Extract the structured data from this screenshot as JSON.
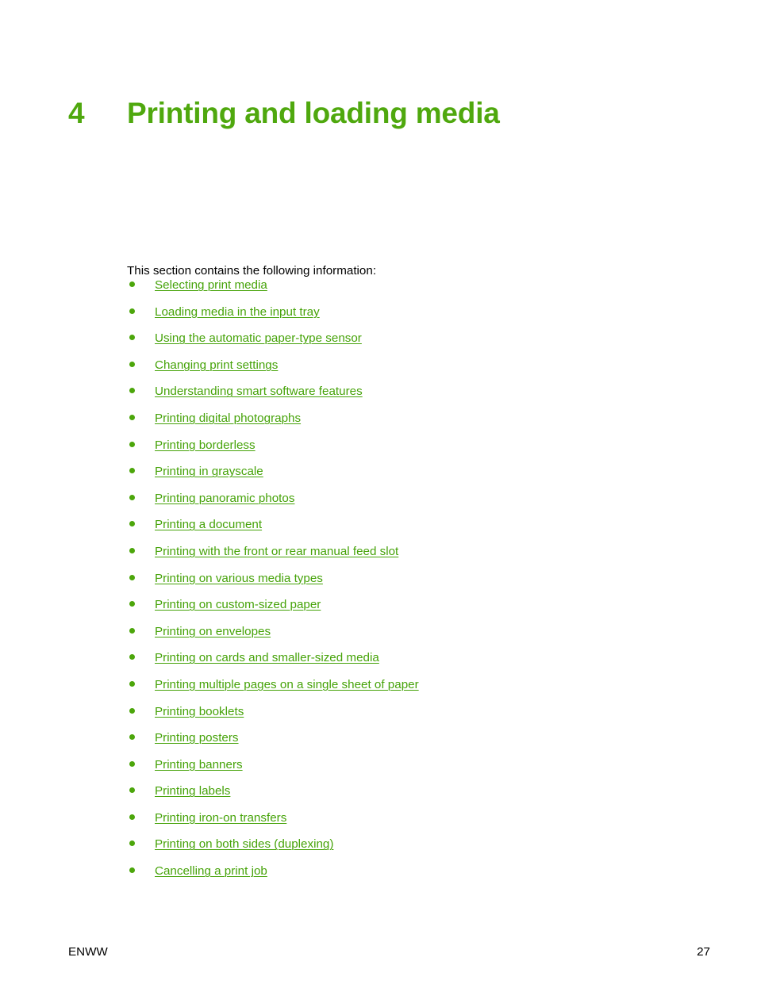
{
  "document": {
    "chapter_number": "4",
    "chapter_title": "Printing and loading media",
    "intro_text": "This section contains the following information:",
    "heading_color": "#4fa80e",
    "link_color": "#46a309",
    "bullet_color": "#4ca60b",
    "body_color": "#000000",
    "page_background": "#ffffff"
  },
  "toc_links": [
    {
      "label": "Selecting print media"
    },
    {
      "label": "Loading media in the input tray"
    },
    {
      "label": "Using the automatic paper-type sensor"
    },
    {
      "label": "Changing print settings"
    },
    {
      "label": "Understanding smart software features"
    },
    {
      "label": "Printing digital photographs"
    },
    {
      "label": "Printing borderless"
    },
    {
      "label": "Printing in grayscale"
    },
    {
      "label": "Printing panoramic photos"
    },
    {
      "label": "Printing a document"
    },
    {
      "label": "Printing with the front or rear manual feed slot"
    },
    {
      "label": "Printing on various media types"
    },
    {
      "label": "Printing on custom-sized paper"
    },
    {
      "label": "Printing on envelopes"
    },
    {
      "label": "Printing on cards and smaller-sized media"
    },
    {
      "label": "Printing multiple pages on a single sheet of paper"
    },
    {
      "label": "Printing booklets"
    },
    {
      "label": "Printing posters"
    },
    {
      "label": "Printing banners"
    },
    {
      "label": "Printing labels"
    },
    {
      "label": "Printing iron-on transfers"
    },
    {
      "label": "Printing on both sides (duplexing)"
    },
    {
      "label": "Cancelling a print job"
    }
  ],
  "footer": {
    "left_label": "ENWW",
    "page_number": "27"
  }
}
